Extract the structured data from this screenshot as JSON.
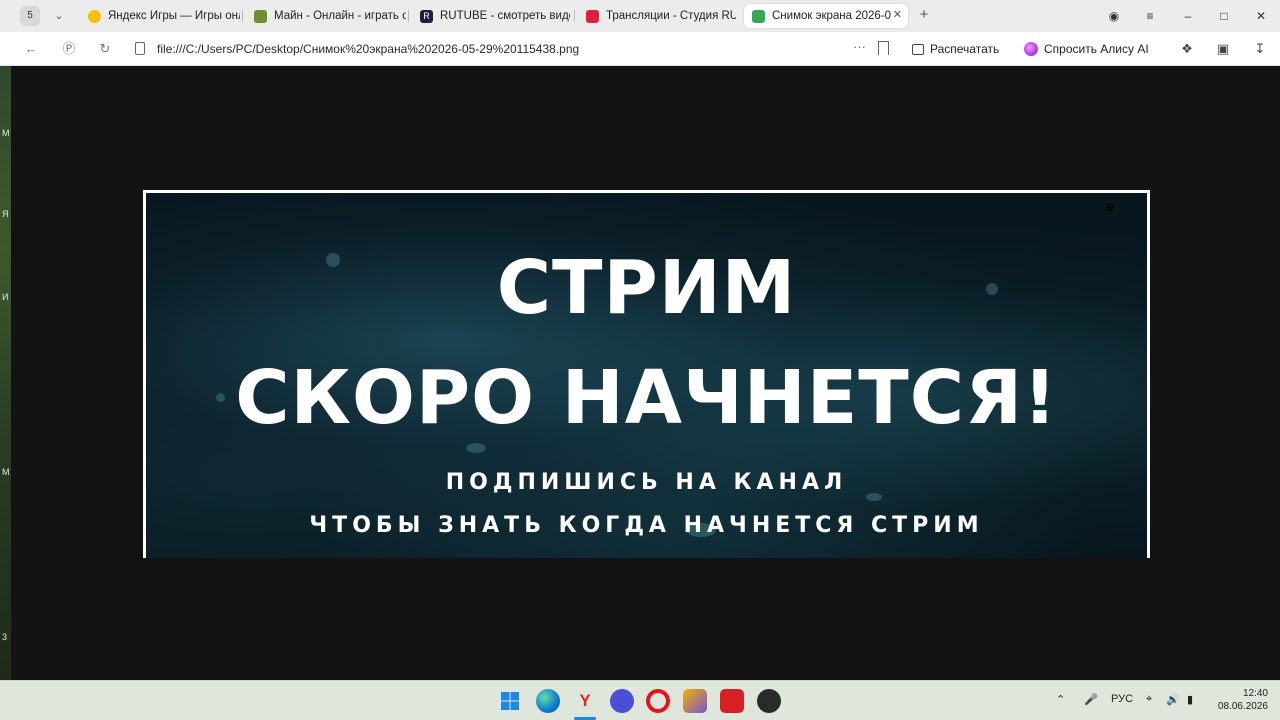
{
  "desktop": {
    "edge_labels": [
      "M",
      "Я",
      "И",
      "M",
      "3"
    ]
  },
  "browser": {
    "tab_count": "5",
    "tabs": [
      {
        "title": "Яндекс Игры — Игры онл",
        "color": "#f2c200"
      },
      {
        "title": "Майн - Онлайн - играть о",
        "color": "#6a8f2e"
      },
      {
        "title": "RUTUBE - смотреть виде",
        "color": "#1b1f3b"
      },
      {
        "title": "Трансляции - Студия RUT",
        "color": "#e0203b"
      },
      {
        "title": "Снимок экрана 2026-0",
        "color": "#34a853"
      }
    ],
    "active_tab_index": 4,
    "address_url": "file:///C:/Users/PC/Desktop/Снимок%20экрана%202026-05-29%20115438.png",
    "print_label": "Распечатать",
    "alice_label": "Спросить Алису AI"
  },
  "content": {
    "line1": "СТРИМ",
    "line2": "СКОРО НАЧНЕТСЯ!",
    "sub1": "ПОДПИШИСЬ НА КАНАЛ",
    "sub2": "ЧТОБЫ ЗНАТЬ КОГДА НАЧНЕТСЯ СТРИМ"
  },
  "taskbar": {
    "apps": [
      "windows-start-icon",
      "edge-icon",
      "yandex-browser-icon",
      "app-icon",
      "opera-icon",
      "game-icon",
      "wps-icon",
      "steam-icon"
    ],
    "lang": "РУС",
    "time": "12:40",
    "date": "08.06.2026"
  }
}
